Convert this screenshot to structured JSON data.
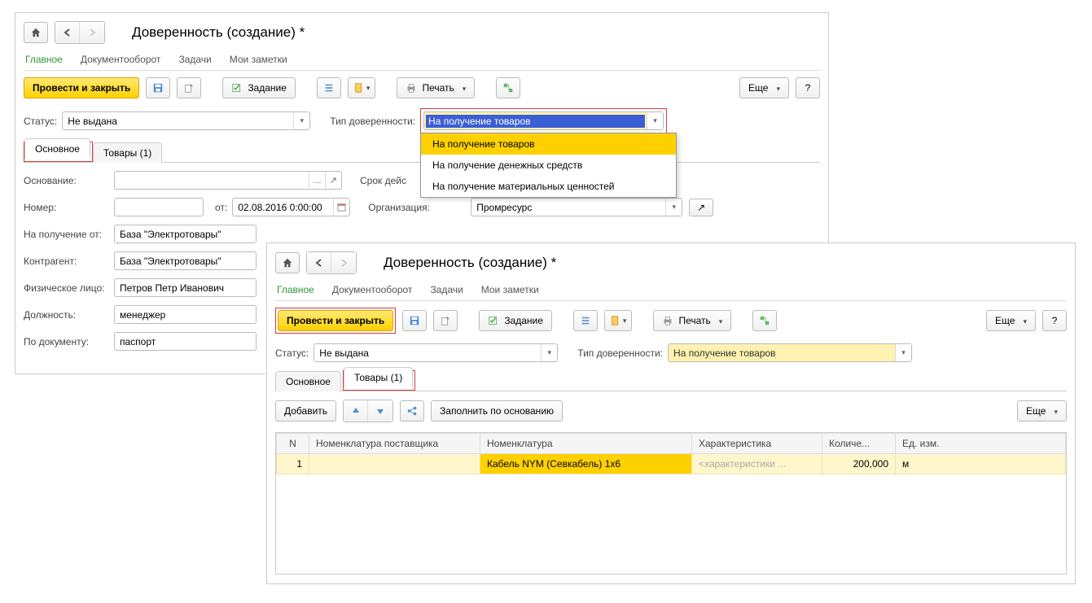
{
  "win1": {
    "title": "Доверенность (создание) *",
    "nav": {
      "main": "Главное",
      "docflow": "Документооборот",
      "tasks": "Задачи",
      "notes": "Мои заметки"
    },
    "toolbar": {
      "commit": "Провести и закрыть",
      "task": "Задание",
      "print": "Печать",
      "more": "Еще",
      "help": "?"
    },
    "status": {
      "label": "Статус:",
      "value": "Не выдана"
    },
    "power_type": {
      "label": "Тип доверенности:",
      "value": "На получение товаров"
    },
    "dropdown": {
      "opt1": "На получение товаров",
      "opt2": "На получение денежных средств",
      "opt3": "На получение материальных ценностей"
    },
    "subtabs": {
      "main": "Основное",
      "goods": "Товары (1)"
    },
    "fields": {
      "basis_label": "Основание:",
      "term_label": "Срок дейс",
      "number_label": "Номер:",
      "from_label": "от:",
      "from_value": "02.08.2016  0:00:00",
      "org_label": "Организация:",
      "org_value": "Промресурс",
      "receive_from_label": "На получение от:",
      "receive_from_value": "База \"Электротовары\"",
      "counterparty_label": "Контрагент:",
      "counterparty_value": "База \"Электротовары\"",
      "person_label": "Физическое лицо:",
      "person_value": "Петров Петр Иванович",
      "position_label": "Должность:",
      "position_value": "менеджер",
      "doc_label": "По документу:",
      "doc_value": "паспорт"
    }
  },
  "win2": {
    "title": "Доверенность (создание) *",
    "nav": {
      "main": "Главное",
      "docflow": "Документооборот",
      "tasks": "Задачи",
      "notes": "Мои заметки"
    },
    "toolbar": {
      "commit": "Провести и закрыть",
      "task": "Задание",
      "print": "Печать",
      "more": "Еще",
      "help": "?"
    },
    "status": {
      "label": "Статус:",
      "value": "Не выдана"
    },
    "power_type": {
      "label": "Тип доверенности:",
      "value": "На получение товаров"
    },
    "subtabs": {
      "main": "Основное",
      "goods": "Товары (1)"
    },
    "tbar2": {
      "add": "Добавить",
      "fill": "Заполнить по основанию",
      "more": "Еще"
    },
    "table": {
      "h_n": "N",
      "h_supplier": "Номенклатура поставщика",
      "h_nom": "Номенклатура",
      "h_char": "Характеристика",
      "h_qty": "Количе...",
      "h_unit": "Ед. изм.",
      "r1_n": "1",
      "r1_nom": "Кабель NYM (Севкабель) 1х6",
      "r1_char": "<характеристики ...",
      "r1_qty": "200,000",
      "r1_unit": "м"
    }
  }
}
